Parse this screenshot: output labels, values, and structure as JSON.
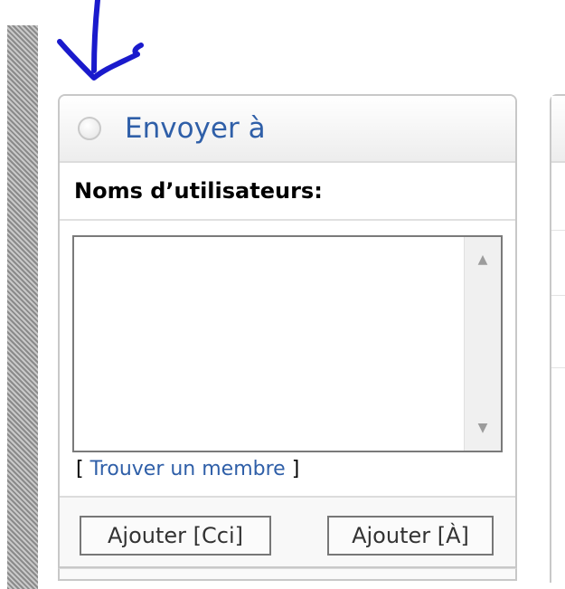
{
  "panel": {
    "title": "Envoyer à",
    "usernames_label": "Noms d’utilisateurs:",
    "usernames_value": "",
    "find_member": {
      "bracket_open": "[",
      "link": "Trouver un membre",
      "bracket_close": "]"
    },
    "buttons": {
      "add_bcc": "Ajouter [Cci]",
      "add_to": "Ajouter [À]"
    }
  },
  "colors": {
    "title": "#2f5fa8",
    "annotation_arrow": "#1a1acc",
    "border": "#c8c8c8"
  },
  "icons": {
    "annotation": "hand-drawn-arrow-icon",
    "radio": "radio-button-icon",
    "scroll_up": "triangle-up-icon",
    "scroll_down": "triangle-down-icon"
  }
}
